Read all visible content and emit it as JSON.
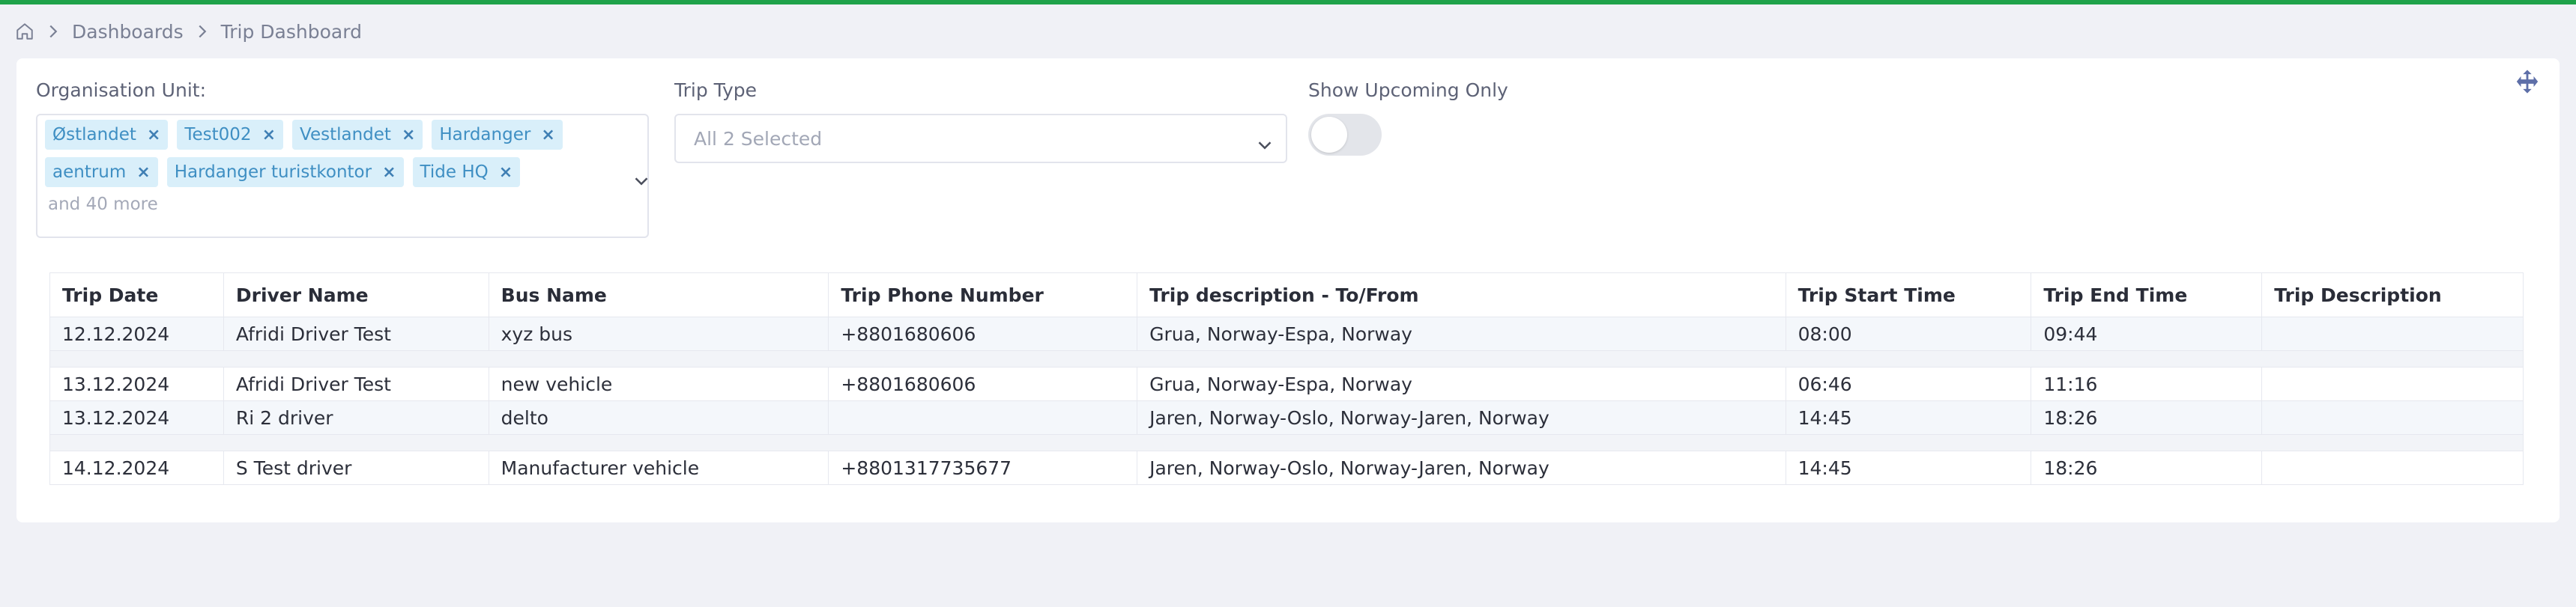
{
  "colors": {
    "accent_bar": "#1fa24a",
    "chip_bg": "#d9effa",
    "chip_text": "#3f8fc3"
  },
  "breadcrumb": {
    "home_icon": "home-icon",
    "items": [
      "Dashboards",
      "Trip Dashboard"
    ]
  },
  "filters": {
    "org_unit": {
      "label": "Organisation Unit:",
      "chips": [
        "Østlandet",
        "Test002",
        "Vestlandet",
        "Hardanger",
        "aentrum",
        "Hardanger turistkontor",
        "Tide HQ"
      ],
      "more_text": "and 40 more"
    },
    "trip_type": {
      "label": "Trip Type",
      "value": "All 2 Selected"
    },
    "upcoming": {
      "label": "Show Upcoming Only",
      "enabled": false
    }
  },
  "table": {
    "headers": [
      "Trip Date",
      "Driver Name",
      "Bus Name",
      "Trip Phone Number",
      "Trip description - To/From",
      "Trip Start Time",
      "Trip End Time",
      "Trip Description"
    ],
    "rows": [
      [
        "12.12.2024",
        "Afridi Driver Test",
        "xyz bus",
        "+8801680606",
        "Grua, Norway-Espa, Norway",
        "08:00",
        "09:44",
        ""
      ],
      [
        "13.12.2024",
        "Afridi Driver Test",
        "new vehicle",
        "+8801680606",
        "Grua, Norway-Espa, Norway",
        "06:46",
        "11:16",
        ""
      ],
      [
        "13.12.2024",
        "Ri 2 driver",
        "delto",
        "",
        "Jaren, Norway-Oslo, Norway-Jaren, Norway",
        "14:45",
        "18:26",
        ""
      ],
      [
        "14.12.2024",
        "S Test driver",
        "Manufacturer vehicle",
        "+8801317735677",
        "Jaren, Norway-Oslo, Norway-Jaren, Norway",
        "14:45",
        "18:26",
        ""
      ]
    ]
  }
}
